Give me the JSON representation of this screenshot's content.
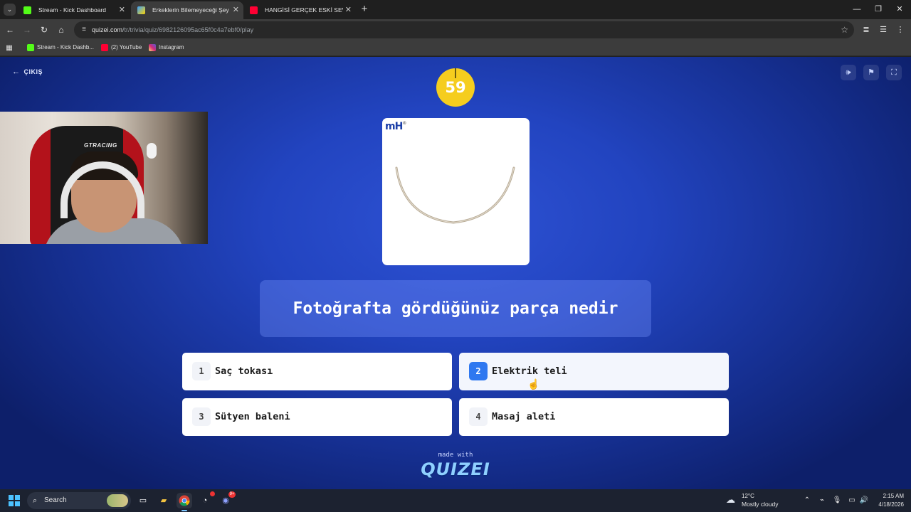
{
  "browser": {
    "tabs": [
      {
        "title": "Stream - Kick Dashboard",
        "favicon": "kick-icon"
      },
      {
        "title": "Erkeklerin Bilemeyeceği Şeyler",
        "favicon": "quizei-icon",
        "active": true
      },
      {
        "title": "HANGİSİ GERÇEK ESKİ SEVGİLİ",
        "favicon": "youtube-icon"
      }
    ],
    "url_host": "quizei.com",
    "url_path": "/tr/trivia/quiz/6982126095ac65f0c4a7ebf0/play",
    "bookmarks": [
      {
        "label": "Stream - Kick Dashb...",
        "icon": "kick-icon"
      },
      {
        "label": "(2) YouTube",
        "icon": "youtube-icon"
      },
      {
        "label": "Instagram",
        "icon": "instagram-icon"
      }
    ]
  },
  "quiz": {
    "exit_label": "ÇIKIŞ",
    "timer": "59",
    "image_logo": "mH",
    "question": "Fotoğrafta gördüğünüz parça nedir",
    "answers": [
      {
        "num": "1",
        "label": "Saç tokası"
      },
      {
        "num": "2",
        "label": "Elektrik teli"
      },
      {
        "num": "3",
        "label": "Sütyen baleni"
      },
      {
        "num": "4",
        "label": "Masaj aleti"
      }
    ],
    "hovered_answer": "2",
    "made_with": "made with",
    "brand": "QUIZEI",
    "webcam_brand": "GTRACING"
  },
  "taskbar": {
    "search_placeholder": "Search",
    "weather_temp": "12°C",
    "weather_condition": "Mostly cloudy",
    "time": "2:15 AM",
    "date": "4/18/2026",
    "discord_badge": "9+"
  },
  "colors": {
    "accent": "#2f78f0",
    "timer": "#f5cd1e",
    "background": "#2244c0"
  }
}
